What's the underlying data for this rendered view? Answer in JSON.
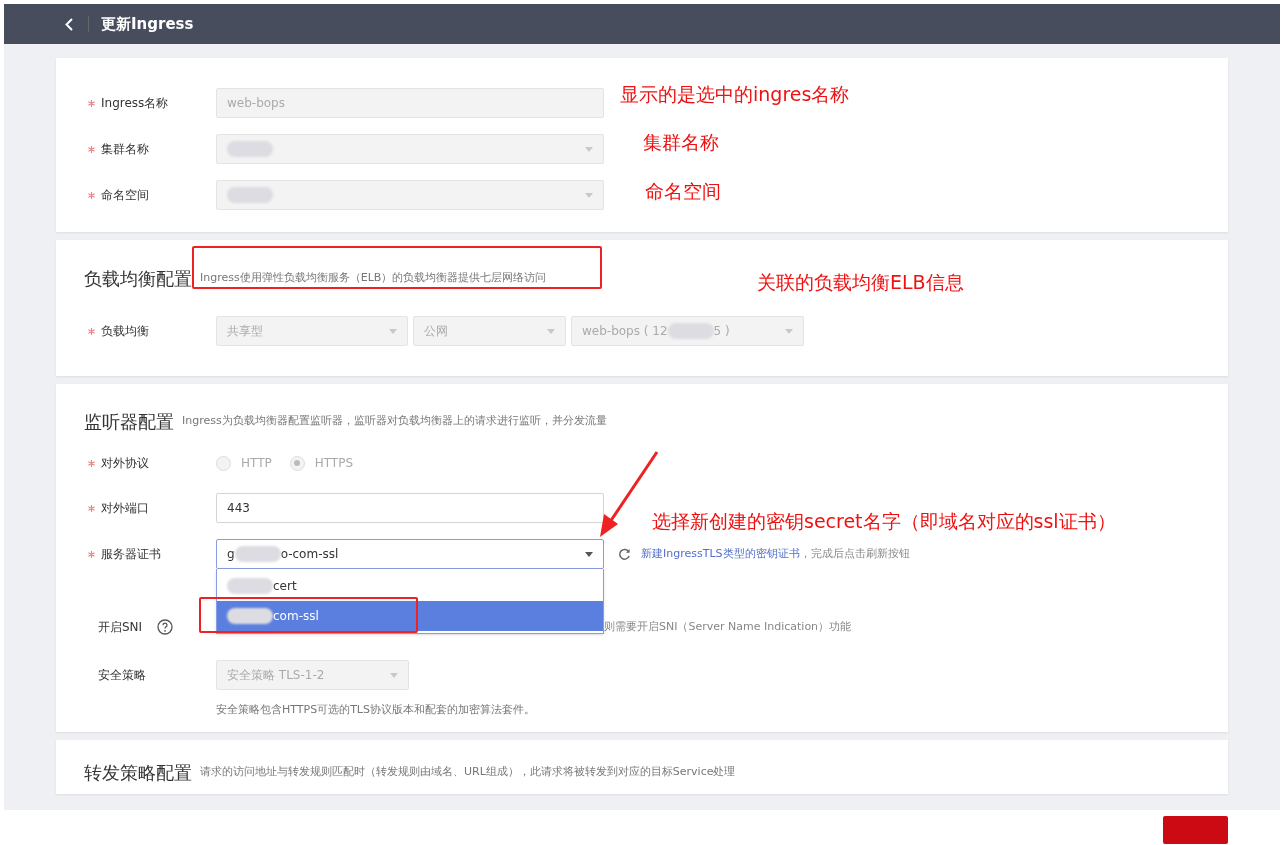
{
  "header": {
    "title": "更新Ingress"
  },
  "basic": {
    "fields": [
      {
        "label": "Ingress名称",
        "required": true,
        "kind": "input",
        "value_parts": [
          "web-bops"
        ],
        "disabled": true
      },
      {
        "label": "集群名称",
        "required": true,
        "kind": "select",
        "redacted": true,
        "disabled": true
      },
      {
        "label": "命名空间",
        "required": true,
        "kind": "select",
        "redacted": true,
        "disabled": true
      }
    ]
  },
  "load_balancer": {
    "title": "负载均衡配置",
    "description": "Ingress使用弹性负载均衡服务（ELB）的负载均衡器提供七层网络访问",
    "label": "负载均衡",
    "required": true,
    "selects": [
      {
        "value_parts": [
          "共享型"
        ]
      },
      {
        "value_parts": [
          "公网"
        ]
      },
      {
        "value_parts": [
          "web-bops ( 12",
          "5 )"
        ]
      }
    ]
  },
  "listener": {
    "title": "监听器配置",
    "description": "Ingress为负载均衡器配置监听器，监听器对负载均衡器上的请求进行监听，并分发流量",
    "protocol": {
      "label": "对外协议",
      "required": true,
      "disabled": true,
      "options": [
        {
          "label": "HTTP",
          "selected": false
        },
        {
          "label": "HTTPS",
          "selected": true
        }
      ]
    },
    "port": {
      "label": "对外端口",
      "required": true,
      "value": "443"
    },
    "certificate": {
      "label": "服务器证书",
      "required": true,
      "value_parts": [
        "g",
        "o-com-ssl"
      ],
      "link": "新建IngressTLS类型的密钥证书",
      "hint": "，完成后点击刷新按钮",
      "options": [
        {
          "text": "cert",
          "selected": false
        },
        {
          "text": "com-ssl",
          "selected": true
        }
      ]
    },
    "sni": {
      "label": "开启SNI",
      "required": false,
      "hint": "则需要开启SNI（Server Name Indication）功能"
    },
    "security_policy": {
      "label": "安全策略",
      "required": false,
      "value": "安全策略 TLS-1-2",
      "disabled": true,
      "help": "安全策略包含HTTPS可选的TLS协议版本和配套的加密算法套件。"
    }
  },
  "forwarding": {
    "title": "转发策略配置",
    "description": "请求的访问地址与转发规则匹配时（转发规则由域名、URL组成），此请求将被转发到对应的目标Service处理"
  },
  "annotations": [
    {
      "text": "显示的是选中的ingres名称"
    },
    {
      "text": "集群名称"
    },
    {
      "text": "命名空间"
    },
    {
      "text": "关联的负载均衡ELB信息"
    },
    {
      "text": "选择新创建的密钥secret名字（即域名对应的ssl证书）"
    }
  ]
}
